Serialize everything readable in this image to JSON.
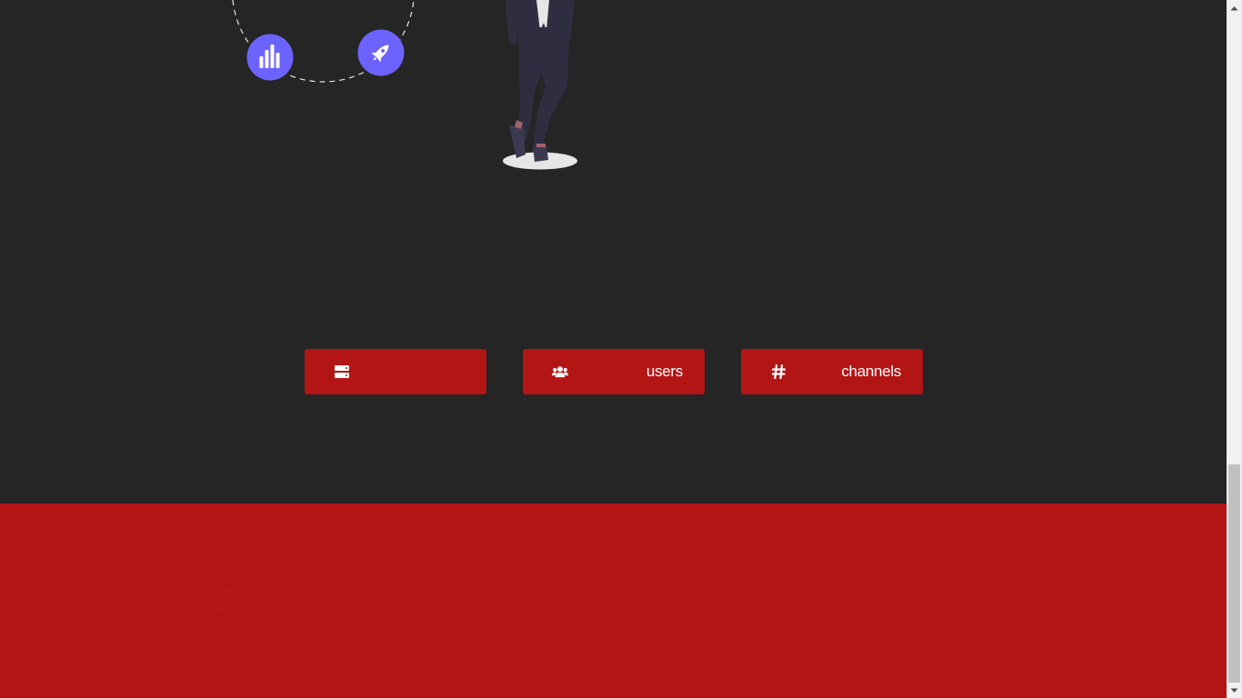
{
  "stats": [
    {
      "icon": "server-icon",
      "label": ""
    },
    {
      "icon": "users-icon",
      "label": "users"
    },
    {
      "icon": "hashtag-icon",
      "label": "channels"
    }
  ],
  "illustration": {
    "orbit_icons": [
      "bar-chart-icon",
      "rocket-icon"
    ],
    "accent_color": "#6c63ff"
  },
  "colors": {
    "background": "#252525",
    "brand_red": "#b31515",
    "text": "#ffffff"
  }
}
